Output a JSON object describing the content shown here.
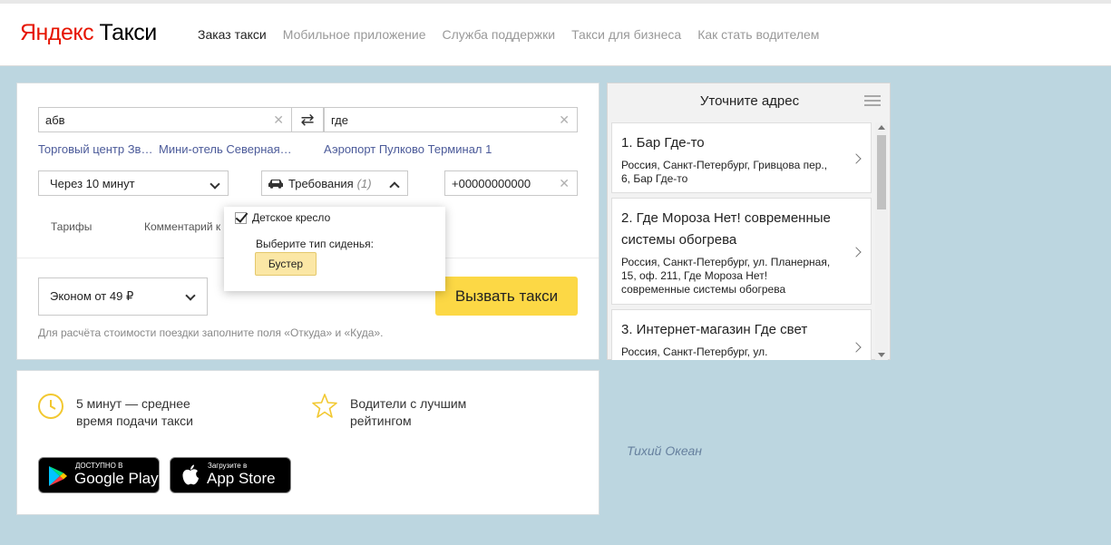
{
  "header": {
    "logo_first": "Яндекс",
    "logo_second": "Такси",
    "nav": [
      {
        "label": "Заказ такси",
        "active": true
      },
      {
        "label": "Мобильное приложение"
      },
      {
        "label": "Служба поддержки"
      },
      {
        "label": "Такси для бизнеса"
      },
      {
        "label": "Как стать водителем"
      }
    ]
  },
  "order": {
    "from_value": "абв",
    "to_value": "где",
    "clear_glyph": "✕",
    "swap_glyph": "⇄",
    "from_suggestions": [
      "Торговый центр Зв…",
      "Мини-отель Северная…"
    ],
    "to_suggestions": [
      "Аэропорт Пулково Терминал 1"
    ],
    "time_value": "Через 10 минут",
    "requirements_label": "Требования",
    "requirements_count": "(1)",
    "phone_value": "+00000000000",
    "tabs": [
      "Тарифы",
      "Комментарий к"
    ],
    "tariff_value": "Эконом от 49 ₽",
    "call_button": "Вызвать такси",
    "hint": "Для расчёта стоимости поездки заполните поля «Откуда» и «Куда»."
  },
  "requirements_popup": {
    "child_seat_label": "Детское кресло",
    "child_seat_checked": true,
    "seat_type_label": "Выберите тип сиденья:",
    "seat_option": "Бустер"
  },
  "promo": {
    "feature1": [
      "5 минут — среднее",
      "время подачи такси"
    ],
    "feature2": [
      "Водители с лучшим",
      "рейтингом"
    ],
    "google_play_small": "ДОСТУПНО В",
    "google_play_big": "Google Play",
    "app_store_small": "Загрузите в",
    "app_store_big": "App Store",
    "icons": {
      "feature1": "clock-icon",
      "feature2": "star-icon"
    }
  },
  "address_panel": {
    "title": "Уточните адрес",
    "results": [
      {
        "name": "1. Бар Где-то",
        "address": "Россия, Санкт-Петербург, Гривцова пер., 6, Бар Где-то"
      },
      {
        "name": "2. Где Мороза Нет! современные системы обогрева",
        "address": "Россия, Санкт-Петербург, ул. Планерная, 15, оф. 211, Где Мороза Нет! современные системы обогрева"
      },
      {
        "name": "3. Интернет-магазин Где свет",
        "address": "Россия, Санкт-Петербург, ул."
      }
    ]
  },
  "map": {
    "label": "Тихий Океан"
  },
  "colors": {
    "accent": "#fcd845",
    "brand_red": "#e61400",
    "map": "#bcd6e0",
    "link": "#4b5a99"
  }
}
